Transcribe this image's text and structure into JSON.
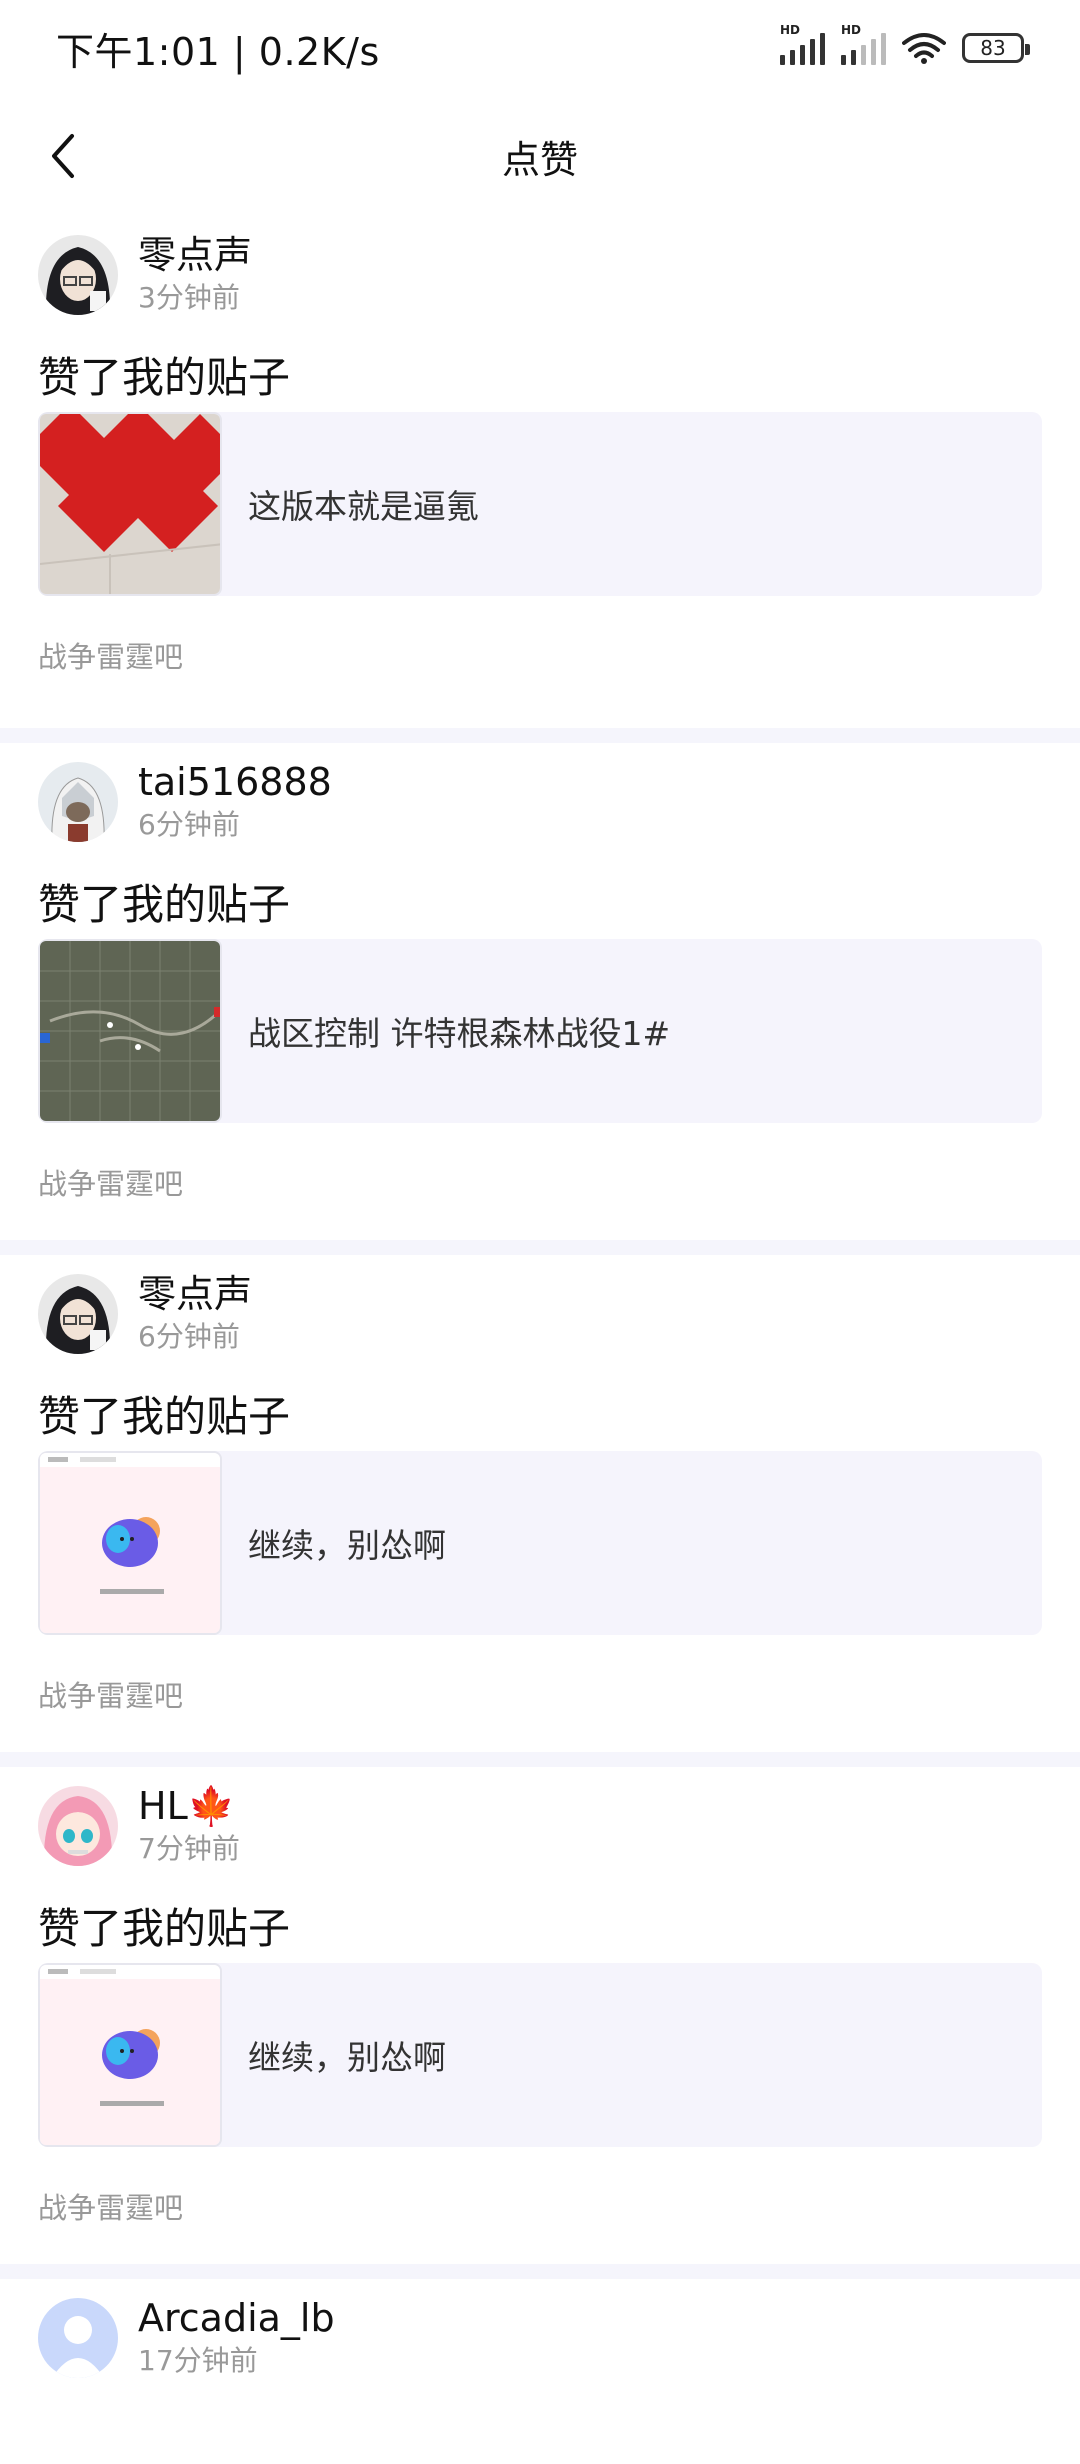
{
  "status_bar": {
    "time_speed": "下午1:01 | 0.2K/s",
    "signal1_label": "HD",
    "signal2_label": "HD",
    "battery": "83"
  },
  "header": {
    "title": "点赞",
    "back_icon": "chevron-left-icon"
  },
  "likes": [
    {
      "username": "零点声",
      "time": "3分钟前",
      "action": "赞了我的贴子",
      "post_title": "这版本就是逼氪",
      "forum": "战争雷霆吧",
      "thumb_type": "red-papers"
    },
    {
      "username": "tai516888",
      "time": "6分钟前",
      "action": "赞了我的贴子",
      "post_title": "战区控制 许特根森林战役1#",
      "forum": "战争雷霆吧",
      "thumb_type": "map"
    },
    {
      "username": "零点声",
      "time": "6分钟前",
      "action": "赞了我的贴子",
      "post_title": "继续，别怂啊",
      "forum": "战争雷霆吧",
      "thumb_type": "app-screen"
    },
    {
      "username": "HL🍁",
      "time": "7分钟前",
      "action": "赞了我的贴子",
      "post_title": "继续，别怂啊",
      "forum": "战争雷霆吧",
      "thumb_type": "app-screen"
    },
    {
      "username": "Arcadia_lb",
      "time": "17分钟前"
    }
  ]
}
